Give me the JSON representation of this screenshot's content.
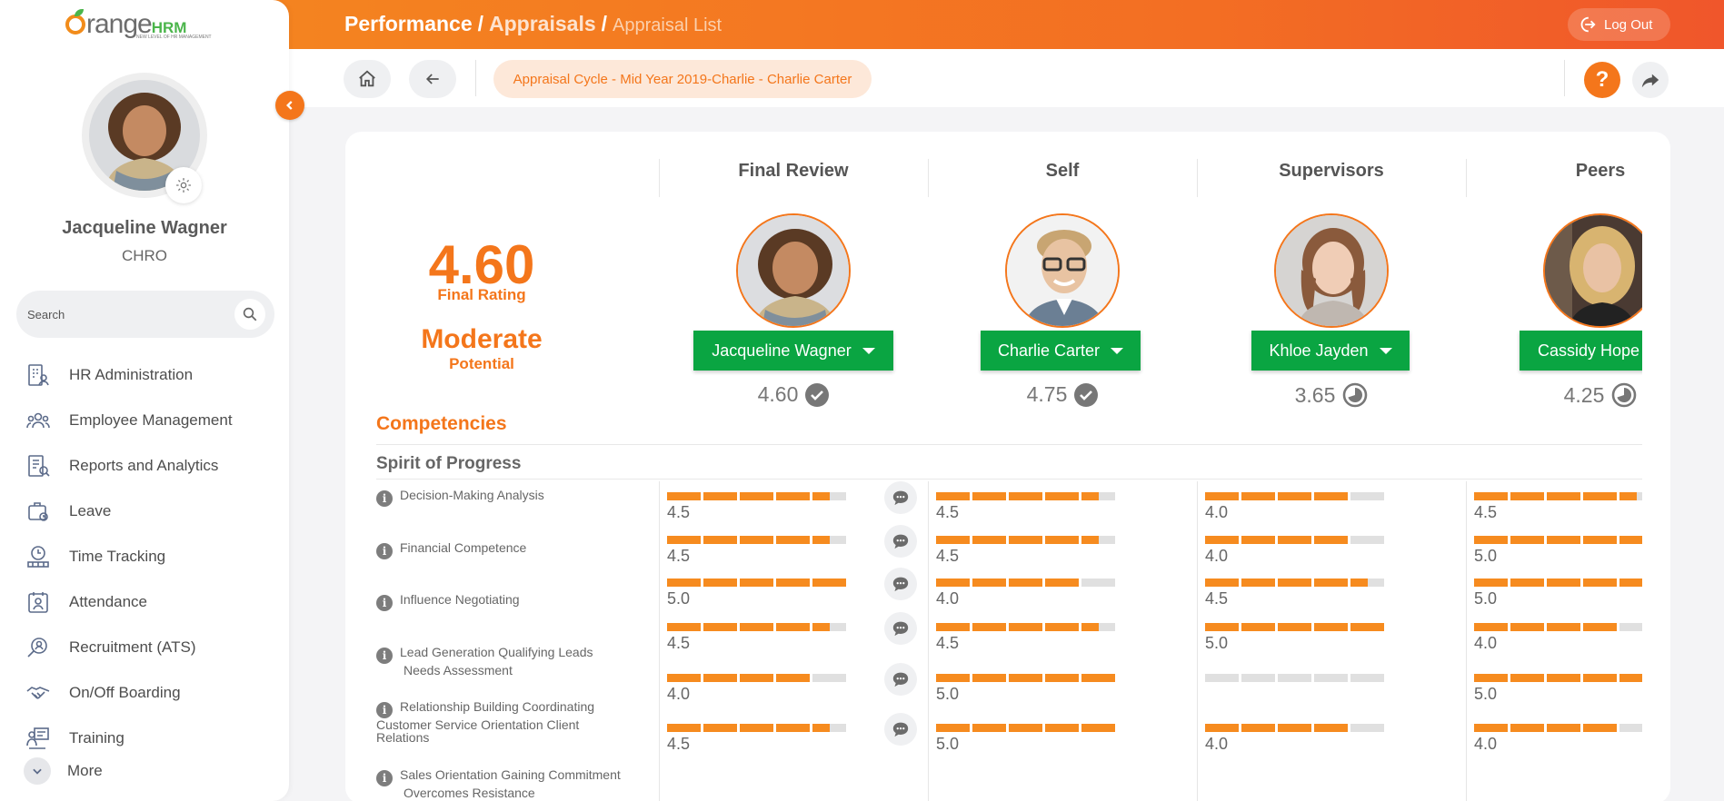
{
  "header": {
    "crumb_module": "Performance",
    "crumb_section": "Appraisals",
    "crumb_page": "Appraisal List",
    "separator": "/",
    "logout_label": "Log Out"
  },
  "logo": {
    "brand_main": "range",
    "brand_suffix": "HRM",
    "tagline": "NEW LEVEL OF HR MANAGEMENT"
  },
  "user": {
    "name": "Jacqueline Wagner",
    "role": "CHRO"
  },
  "search": {
    "placeholder": "Search"
  },
  "menu": [
    {
      "label": "HR Administration",
      "icon": "hr-admin-icon"
    },
    {
      "label": "Employee Management",
      "icon": "employees-icon"
    },
    {
      "label": "Reports and Analytics",
      "icon": "reports-icon"
    },
    {
      "label": "Leave",
      "icon": "leave-icon"
    },
    {
      "label": "Time Tracking",
      "icon": "time-icon"
    },
    {
      "label": "Attendance",
      "icon": "attendance-icon"
    },
    {
      "label": "Recruitment (ATS)",
      "icon": "recruitment-icon"
    },
    {
      "label": "On/Off Boarding",
      "icon": "onboarding-icon"
    },
    {
      "label": "Training",
      "icon": "training-icon"
    }
  ],
  "menu_more": "More",
  "toolbar": {
    "cycle_label": "Appraisal Cycle - Mid Year 2019-Charlie - Charlie Carter",
    "help_label": "?"
  },
  "summary": {
    "final_rating": "4.60",
    "final_rating_label": "Final Rating",
    "potential": "Moderate",
    "potential_label": "Potential"
  },
  "columns": [
    {
      "header": "Final Review",
      "reviewer": "Jacqueline Wagner",
      "score": "4.60",
      "status_icon": "check-circle-icon"
    },
    {
      "header": "Self",
      "reviewer": "Charlie Carter",
      "score": "4.75",
      "status_icon": "check-circle-icon"
    },
    {
      "header": "Supervisors",
      "reviewer": "Khloe Jayden",
      "score": "3.65",
      "status_icon": "in-progress-icon"
    },
    {
      "header": "Peers",
      "reviewer": "Cassidy Hope",
      "score": "4.25",
      "status_icon": "in-progress-icon"
    }
  ],
  "competencies": {
    "title": "Competencies",
    "group": "Spirit of Progress",
    "criteria": [
      {
        "name": "Decision-Making Analysis",
        "ratings": [
          "4.5",
          "4.5",
          "4.0",
          "4.5"
        ],
        "values": [
          4.5,
          4.5,
          4.0,
          4.5
        ]
      },
      {
        "name": "Financial Competence",
        "ratings": [
          "4.5",
          "4.5",
          "4.0",
          "5.0"
        ],
        "values": [
          4.5,
          4.5,
          4.0,
          5.0
        ]
      },
      {
        "name": "Influence Negotiating",
        "ratings": [
          "5.0",
          "4.0",
          "4.5",
          "5.0"
        ],
        "values": [
          5.0,
          4.0,
          4.5,
          5.0
        ]
      },
      {
        "name": "Lead Generation Qualifying Leads Needs Assessment",
        "ratings": [
          "4.5",
          "4.5",
          "5.0",
          "4.0"
        ],
        "values": [
          4.5,
          4.5,
          5.0,
          4.0
        ]
      },
      {
        "name": "Relationship Building Coordinating Customer Service Orientation Client Relations",
        "ratings": [
          "4.0",
          "5.0",
          "",
          "5.0"
        ],
        "values": [
          4.0,
          5.0,
          0,
          5.0
        ]
      },
      {
        "name": "Sales Orientation Gaining Commitment Overcomes Resistance",
        "ratings": [
          "4.5",
          "5.0",
          "4.0",
          "4.0"
        ],
        "values": [
          4.5,
          5.0,
          4.0,
          4.0
        ]
      }
    ]
  },
  "colors": {
    "accent": "#f4761b",
    "button_green": "#0aa542",
    "bar_fill": "#f68b1f",
    "bar_empty": "#e0e0e0"
  }
}
